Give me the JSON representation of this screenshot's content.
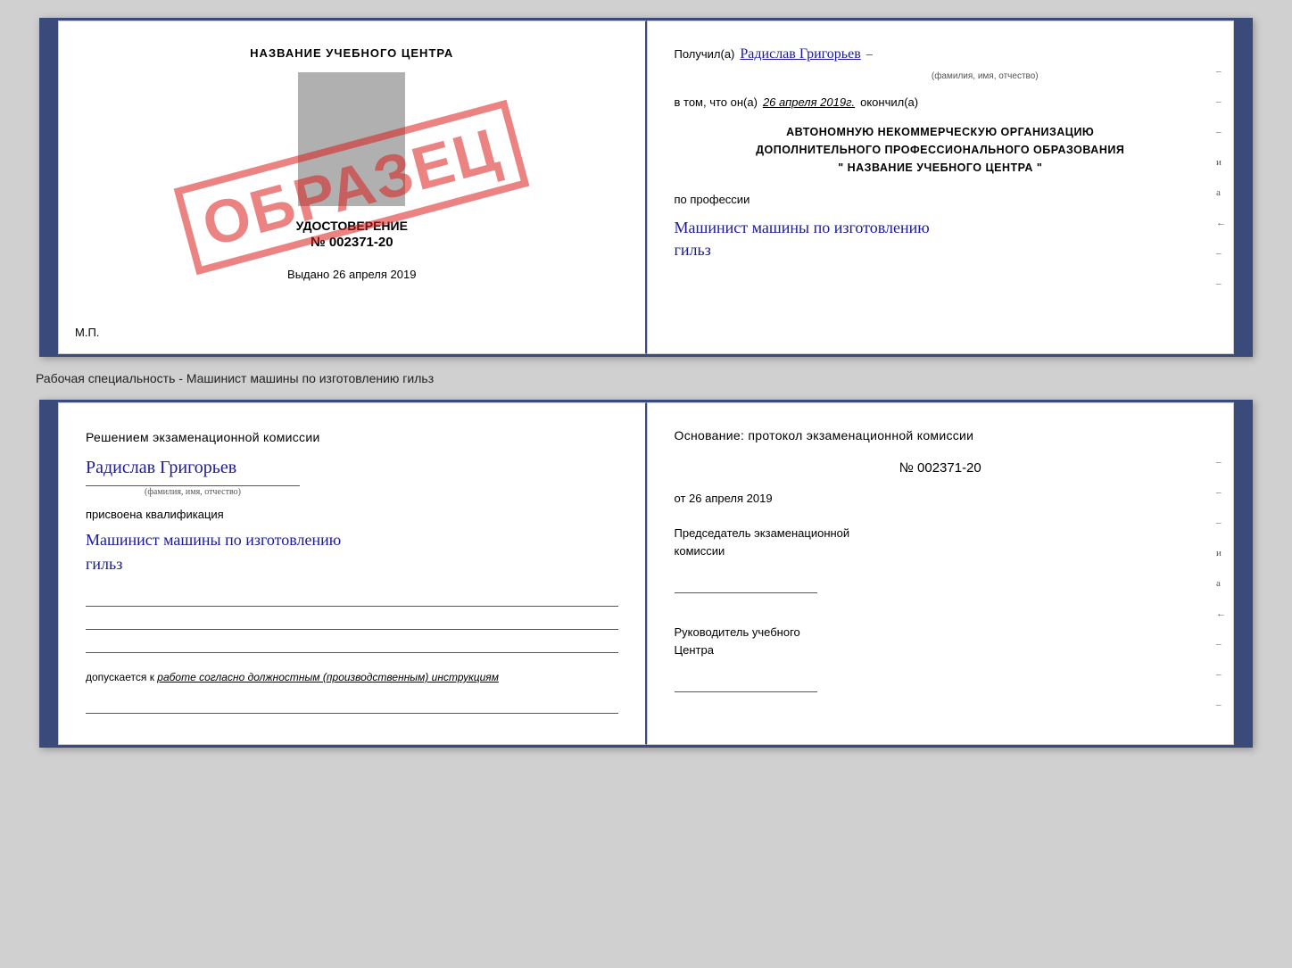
{
  "top_cert": {
    "left": {
      "title": "НАЗВАНИЕ УЧЕБНОГО ЦЕНТРА",
      "udostoverenie": "УДОСТОВЕРЕНИЕ",
      "number": "№ 002371-20",
      "vydano_label": "Выдано",
      "vydano_date": "26 апреля 2019",
      "mp": "М.П.",
      "stamp": "ОБРАЗЕЦ"
    },
    "right": {
      "poluchil_label": "Получил(а)",
      "recipient_name": "Радислав Григорьев",
      "fio_label": "(фамилия, имя, отчество)",
      "vtom_label": "в том, что он(а)",
      "date": "26 апреля 2019г.",
      "okonchil_label": "окончил(а)",
      "org_line1": "АВТОНОМНУЮ НЕКОММЕРЧЕСКУЮ ОРГАНИЗАЦИЮ",
      "org_line2": "ДОПОЛНИТЕЛЬНОГО ПРОФЕССИОНАЛЬНОГО ОБРАЗОВАНИЯ",
      "org_name": "\"   НАЗВАНИЕ УЧЕБНОГО ЦЕНТРА   \"",
      "profession_label": "по профессии",
      "profession_handwriting": "Машинист машины по изготовлению",
      "profession_handwriting2": "гильз",
      "side_marks": [
        "–",
        "–",
        "и",
        "а",
        "←",
        "–",
        "–",
        "–"
      ]
    }
  },
  "separator": {
    "label": "Рабочая специальность - Машинист машины по изготовлению гильз"
  },
  "bottom_cert": {
    "left": {
      "resheniye": "Решением  экзаменационной  комиссии",
      "name_handwriting": "Радислав Григорьев",
      "fio_label": "(фамилия, имя, отчество)",
      "assigned_label": "присвоена квалификация",
      "profession_handwriting": "Машинист машины по изготовлению",
      "profession_handwriting2": "гильз",
      "dopusk_label": "допускается к",
      "dopusk_text": "работе согласно должностным (производственным) инструкциям"
    },
    "right": {
      "osnovaniye": "Основание: протокол экзаменационной  комиссии",
      "number": "№  002371-20",
      "ot_label": "от",
      "date": "26 апреля 2019",
      "predsedatel_line1": "Председатель экзаменационной",
      "predsedatel_line2": "комиссии",
      "rukovoditel_line1": "Руководитель учебного",
      "rukovoditel_line2": "Центра",
      "side_marks": [
        "–",
        "–",
        "–",
        "и",
        "а",
        "←",
        "–",
        "–",
        "–"
      ]
    }
  }
}
